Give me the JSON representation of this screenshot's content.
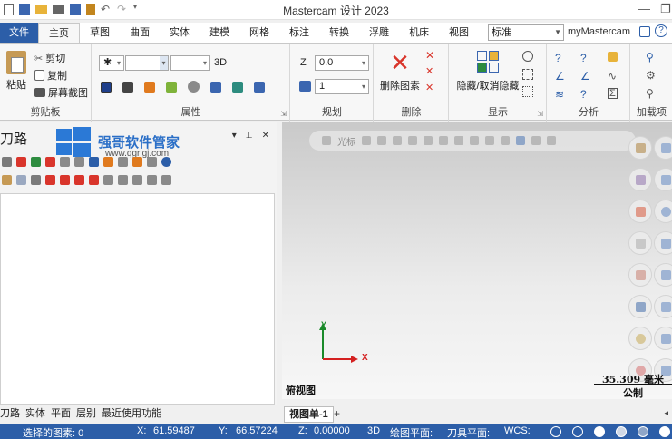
{
  "app": {
    "title": "Mastercam 设计 2023"
  },
  "window_controls": {
    "minimize": "—",
    "restore": "❐"
  },
  "tabs": [
    {
      "label": "文件"
    },
    {
      "label": "主页"
    },
    {
      "label": "草图"
    },
    {
      "label": "曲面"
    },
    {
      "label": "实体"
    },
    {
      "label": "建模"
    },
    {
      "label": "网格"
    },
    {
      "label": "标注"
    },
    {
      "label": "转换"
    },
    {
      "label": "浮雕"
    },
    {
      "label": "机床"
    },
    {
      "label": "视图"
    }
  ],
  "ribbon_right": {
    "style_select": "标准",
    "my_mastercam": "myMastercam"
  },
  "ribbon": {
    "clipboard": {
      "paste": "粘贴",
      "cut": "剪切",
      "copy": "复制",
      "screenshot": "屏幕截图",
      "label": "剪贴板"
    },
    "attributes": {
      "mode_3d": "3D",
      "label": "属性"
    },
    "planning": {
      "z_label": "Z",
      "z_value": "0.0",
      "level_value": "1",
      "label": "规划"
    },
    "delete": {
      "delete_entity": "删除图素",
      "label": "删除"
    },
    "display": {
      "hide_unhide": "隐藏/取消隐藏",
      "label": "显示"
    },
    "analyze": {
      "label": "分析"
    },
    "addons": {
      "label": "加载项"
    }
  },
  "panel": {
    "title": "刀路",
    "controls": {
      "dropdown": "▾",
      "pin": "📌",
      "close": "✕"
    },
    "watermark": {
      "name": "强哥软件管家",
      "url": "www.qgrjgj.com"
    }
  },
  "panel_tabs": [
    {
      "label": "刀路"
    },
    {
      "label": "实体"
    },
    {
      "label": "平面"
    },
    {
      "label": "层别"
    },
    {
      "label": "最近使用功能"
    }
  ],
  "viewport": {
    "toolbar_label": "光标",
    "view_name": "俯视图",
    "axis_x": "X",
    "axis_y": "Y",
    "scale_value": "35.309 毫米",
    "scale_unit": "公制"
  },
  "viewport_tabs": {
    "sheet": "视图单-1",
    "add": "+",
    "nav": "◂"
  },
  "status": {
    "selected": "选择的图素: 0",
    "x_label": "X:",
    "x_value": "61.59487",
    "y_label": "Y:",
    "y_value": "66.57224",
    "z_label": "Z:",
    "z_value": "0.00000",
    "mode": "3D",
    "cplane": "绘图平面:",
    "tplane": "刀具平面:",
    "wcs": "WCS:"
  },
  "colors": {
    "accent": "#2c5ea8",
    "delete_red": "#d9352b",
    "axis_x": "#d42020",
    "axis_y": "#1a8a2a"
  }
}
